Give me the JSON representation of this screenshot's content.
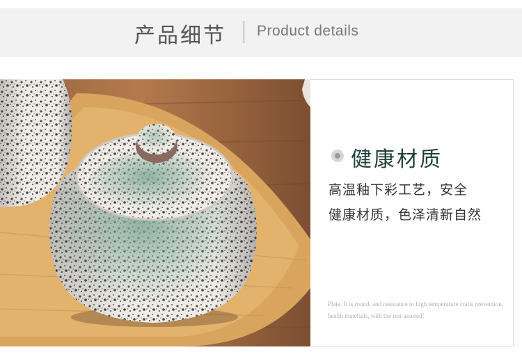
{
  "header": {
    "title_cn": "产品细节",
    "title_en": "Product  details"
  },
  "feature": {
    "title": "健康材质",
    "desc_line1": "高温釉下彩工艺，安全",
    "desc_line2": "健康材质，色泽清新自然",
    "note_en": "Plate. It is round, and resistance to high temperature crack prevention, health materials, with the rest assured!"
  },
  "icons": {
    "bullet": "bullet-dot-icon"
  },
  "colors": {
    "header_bg": "#f2f2f2",
    "title_color": "#1f3f3a",
    "glaze_green": "#7fa897",
    "wood": "#d9a45e"
  }
}
